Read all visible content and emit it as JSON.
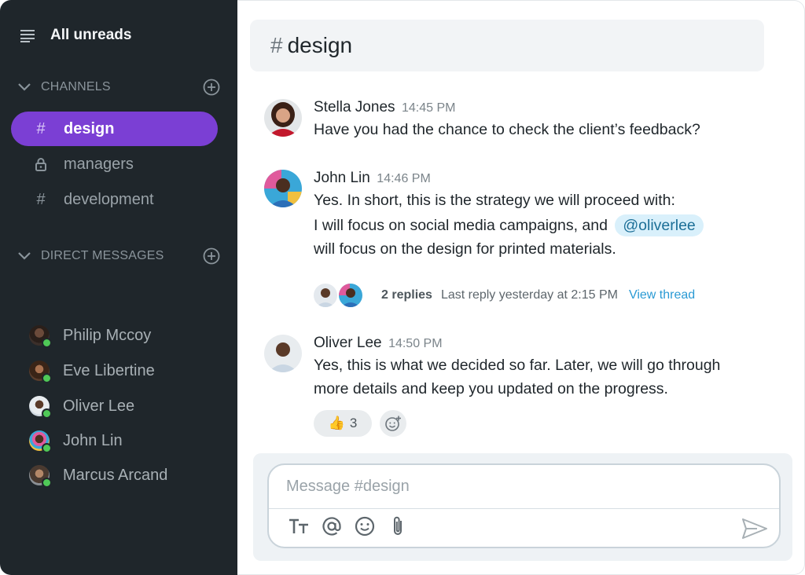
{
  "sidebar": {
    "all_unreads": "All unreads",
    "channels_heading": "CHANNELS",
    "channels": [
      {
        "name": "design",
        "icon": "hash-icon",
        "active": true
      },
      {
        "name": "managers",
        "icon": "lock-icon",
        "active": false
      },
      {
        "name": "development",
        "icon": "hash-icon",
        "active": false
      }
    ],
    "dm_heading": "DIRECT MESSAGES",
    "direct_messages": [
      {
        "name": "Philip Mccoy",
        "status": "online"
      },
      {
        "name": "Eve Libertine",
        "status": "online"
      },
      {
        "name": "Oliver Lee",
        "status": "online"
      },
      {
        "name": "John Lin",
        "status": "online"
      },
      {
        "name": "Marcus Arcand",
        "status": "online"
      }
    ]
  },
  "channel_header": {
    "hash": "#",
    "title": "design"
  },
  "messages": [
    {
      "author": "Stella Jones",
      "time": "14:45 PM",
      "lines": [
        "Have you had the chance to check the client’s feedback?"
      ]
    },
    {
      "author": "John Lin",
      "time": "14:46 PM",
      "lines": [
        "Yes. In short, this is the strategy we will proceed with:",
        "I will focus on social media campaigns, and",
        "will focus on the design for printed materials."
      ],
      "mention": "@oliverlee",
      "thread": {
        "replies": "2 replies",
        "last_reply": "Last reply yesterday at 2:15 PM",
        "view": "View thread"
      }
    },
    {
      "author": "Oliver Lee",
      "time": "14:50 PM",
      "lines": [
        "Yes, this is what we decided so far. Later, we will go through",
        "more details and keep you updated on the progress."
      ],
      "reaction": {
        "emoji": "👍",
        "count": "3"
      }
    }
  ],
  "composer": {
    "placeholder": "Message #design",
    "tools": [
      "text-format-icon",
      "mention-icon",
      "emoji-icon",
      "attachment-icon"
    ],
    "send_icon": "send-icon"
  },
  "colors": {
    "sidebar_bg": "#1f262b",
    "active_channel": "#7b3fd4",
    "online": "#4fc957",
    "link": "#2a9ad4",
    "mention_bg": "#d9f0fb"
  }
}
